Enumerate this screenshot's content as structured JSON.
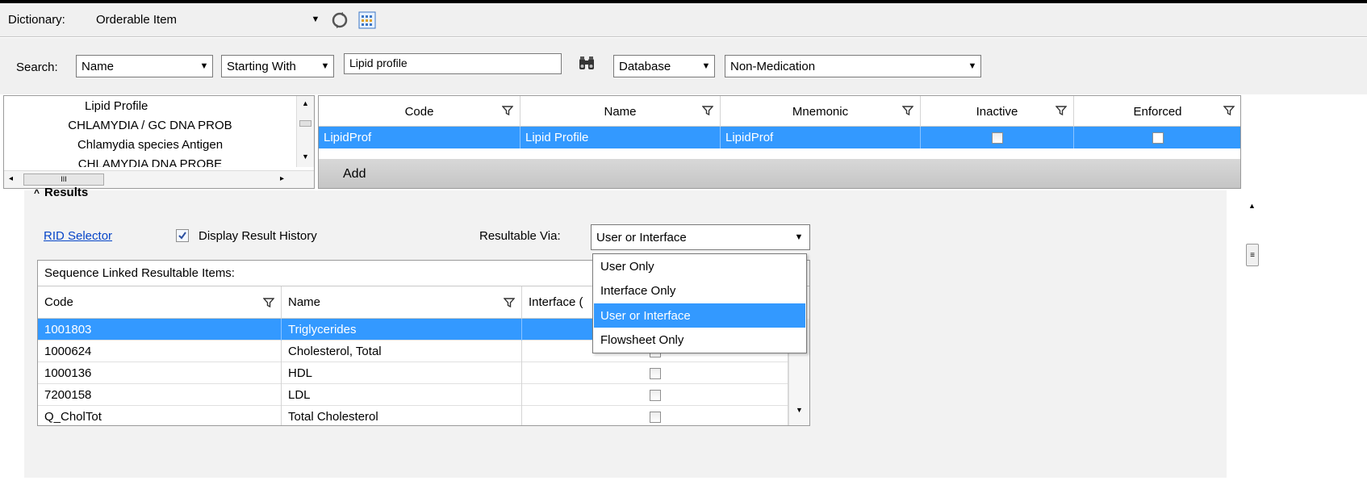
{
  "dictionary": {
    "label": "Dictionary:",
    "value": "Orderable Item"
  },
  "search": {
    "label": "Search:",
    "field": "Name",
    "mode": "Starting With",
    "query": "Lipid profile",
    "source": "Database",
    "type": "Non-Medication"
  },
  "left_list": {
    "items": [
      "Lipid Profile",
      "CHLAMYDIA / GC DNA PROB",
      "Chlamydia species Antigen",
      "CHLAMYDIA DNA PROBE"
    ],
    "hscroll_glyph": "III"
  },
  "orderables_grid": {
    "columns": [
      "Code",
      "Name",
      "Mnemonic",
      "Inactive",
      "Enforced"
    ],
    "rows": [
      {
        "code": "LipidProf",
        "name": "Lipid Profile",
        "mnemonic": "LipidProf"
      }
    ],
    "add_label": "Add"
  },
  "results": {
    "title": "Results",
    "rid_selector": "RID Selector",
    "display_history_label": "Display Result History",
    "resultable_via_label": "Resultable Via:",
    "resultable_via_value": "User or Interface",
    "dropdown_options": [
      "User Only",
      "Interface Only",
      "User or Interface",
      "Flowsheet Only"
    ],
    "linked_caption": "Sequence Linked Resultable Items:",
    "columns": [
      "Code",
      "Name",
      "Interface ("
    ],
    "rows": [
      {
        "code": "1001803",
        "name": "Triglycerides"
      },
      {
        "code": "1000624",
        "name": "Cholesterol, Total"
      },
      {
        "code": "1000136",
        "name": "HDL"
      },
      {
        "code": "7200158",
        "name": "LDL"
      },
      {
        "code": "Q_CholTot",
        "name": "Total Cholesterol"
      }
    ]
  },
  "colors": {
    "selection": "#3399ff",
    "link": "#0645c8",
    "toolbar_bg": "#f0f0f0"
  }
}
